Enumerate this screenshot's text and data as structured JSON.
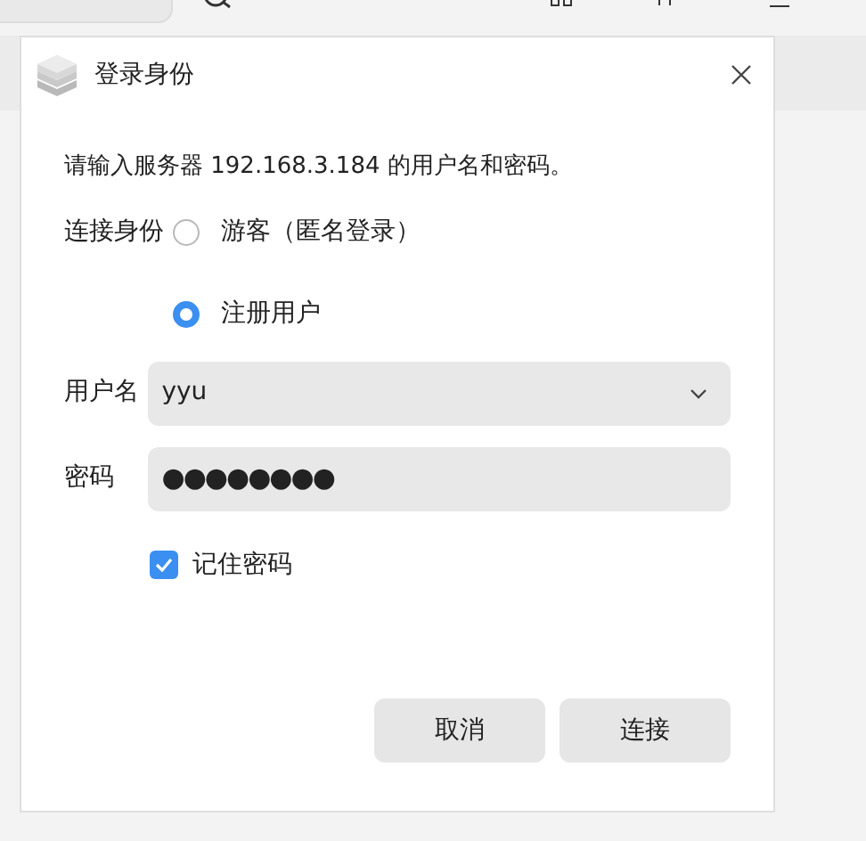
{
  "dialog": {
    "title": "登录身份",
    "message": "请输入服务器 192.168.3.184 的用户名和密码。",
    "identity_label": "连接身份",
    "identity_options": [
      {
        "label": "游客（匿名登录）",
        "selected": false
      },
      {
        "label": "注册用户",
        "selected": true
      }
    ],
    "username": {
      "label": "用户名",
      "value": "yyu"
    },
    "password": {
      "label": "密码",
      "value": "●●●●●●●●"
    },
    "remember_password": {
      "label": "记住密码",
      "checked": true
    },
    "buttons": [
      "取消",
      "连接"
    ]
  }
}
